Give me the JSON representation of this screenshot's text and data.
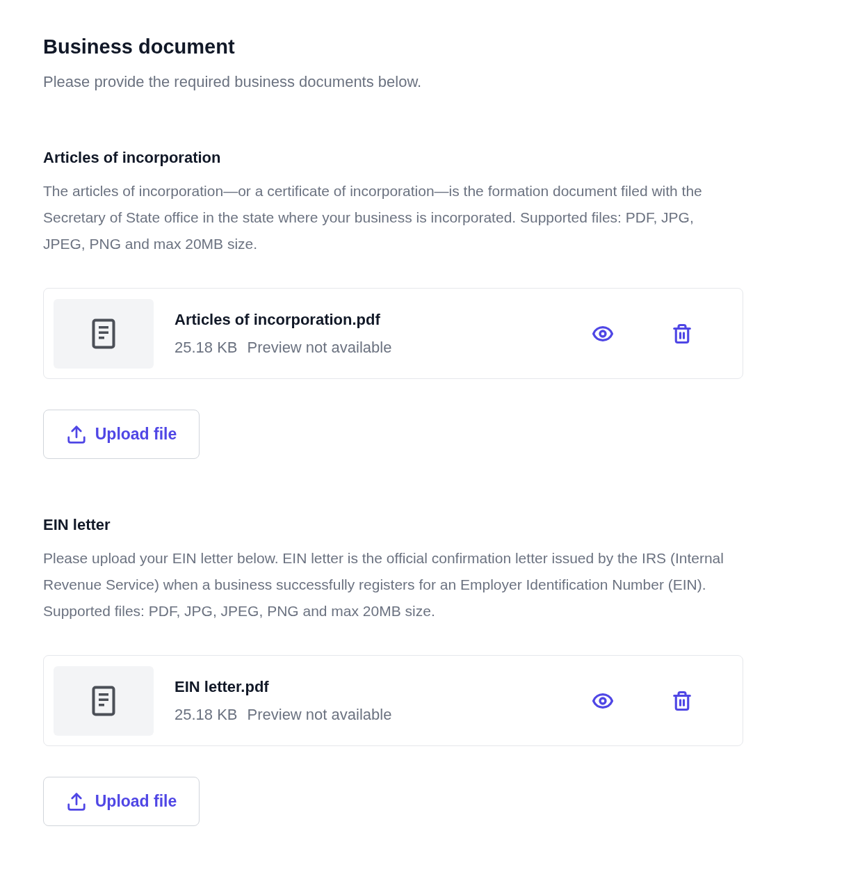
{
  "header": {
    "title": "Business document",
    "subtitle": "Please provide the required business documents below."
  },
  "sections": [
    {
      "heading": "Articles of incorporation",
      "description": "The articles of incorporation—or a certificate of incorporation—is the formation document filed with the Secretary of State office in the state where your business is incorporated. Supported files: PDF, JPG, JPEG, PNG and max 20MB size.",
      "files": [
        {
          "name": "Articles of incorporation.pdf",
          "size": "25.18 KB",
          "note": "Preview not available"
        }
      ],
      "upload_button": "Upload file"
    },
    {
      "heading": "EIN letter",
      "description": "Please upload your EIN letter below. EIN letter is the official confirmation letter issued by the IRS (Internal Revenue Service) when a business successfully registers for an Employer Identification Number (EIN). Supported files: PDF, JPG, JPEG, PNG and max 20MB size.",
      "files": [
        {
          "name": "EIN letter.pdf",
          "size": "25.18 KB",
          "note": "Preview not available"
        }
      ],
      "upload_button": "Upload file"
    }
  ]
}
